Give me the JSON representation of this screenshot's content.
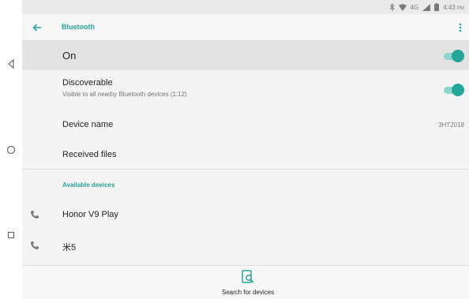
{
  "status_bar": {
    "network": "4G",
    "time": "4:43",
    "ampm": "PM"
  },
  "toolbar": {
    "title": "Bluetooth"
  },
  "settings": {
    "bluetooth_toggle": {
      "label": "On",
      "checked": true
    },
    "discoverable": {
      "label": "Discoverable",
      "subtitle": "Visible to all nearby Bluetooth devices (1:12)",
      "checked": true
    },
    "device_name": {
      "label": "Device name",
      "value": "3HT2018"
    },
    "received_files": {
      "label": "Received files"
    }
  },
  "available_devices": {
    "header": "Available devices",
    "items": [
      {
        "label": "Honor V9 Play",
        "icon": "phone-icon"
      },
      {
        "label": "米5",
        "icon": "phone-icon"
      }
    ]
  },
  "bottom_action": {
    "label": "Search for devices",
    "icon": "search-device-icon"
  },
  "colors": {
    "accent": "#26a69a",
    "accent_light": "#8fd6cd",
    "highlight_row": "#e3e3e3"
  }
}
